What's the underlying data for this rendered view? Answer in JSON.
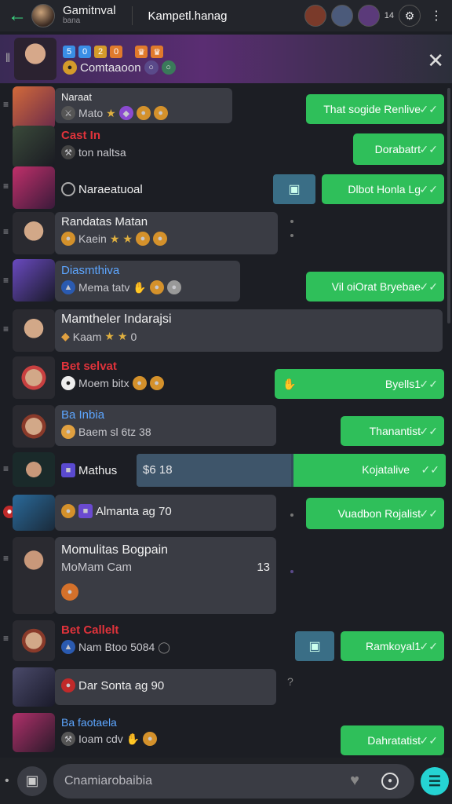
{
  "topbar": {
    "title": "Gamitnval",
    "subtitle": "bana",
    "center": "Kampetl.hanag",
    "counter": "14"
  },
  "banner": {
    "name": "Comtaaoon",
    "badges": [
      "5",
      "0",
      "2",
      "0"
    ]
  },
  "rows": [
    {
      "name": "Naraat",
      "sub": "Mato",
      "name_style": "normal"
    },
    {
      "name": "Cast In",
      "sub": "ton naltsa",
      "name_style": "red"
    },
    {
      "name": "Naraeatuoal",
      "sub": "",
      "name_style": "normal"
    },
    {
      "name": "Randatas Matan",
      "sub": "Kaein",
      "name_style": "normal"
    },
    {
      "name": "Diasmthiva",
      "sub": "Mema tatv",
      "name_style": "blue"
    },
    {
      "name": "Mamtheler Indarajsi",
      "sub": "Kaam",
      "count": "0",
      "name_style": "normal"
    },
    {
      "name": "Bet selvat",
      "sub": "Moem bitx",
      "name_style": "red"
    },
    {
      "name": "Ba Inbia",
      "sub": "Baem sl 6tz 38",
      "name_style": "blue"
    },
    {
      "name": "Mathus",
      "sub": "",
      "name_style": "normal"
    },
    {
      "name": "Almanta ag 70",
      "sub": "",
      "name_style": "normal"
    },
    {
      "name": "Momulitas Bogpain",
      "sub": "MoMam Cam",
      "count": "13",
      "name_style": "normal"
    },
    {
      "name": "Bet Callelt",
      "sub": "Nam Btoo 5084",
      "name_style": "red"
    },
    {
      "name": "Dar Sonta ag 90",
      "sub": "",
      "name_style": "normal"
    },
    {
      "name": "Ba faotaela",
      "sub": "Ioam cdv",
      "name_style": "blue"
    }
  ],
  "right_msgs": [
    "That sogide Renlive",
    "Dorabatrt",
    "Dlbot Honla Lg",
    "Vil oiOrat Bryebae",
    "Byells1",
    "Thanantist",
    "Kojatalive",
    "Vuadbon Rojalist",
    "Ramkoyal1",
    "Dahratatist"
  ],
  "progress": {
    "value_text": "$6 18",
    "level": 0.5
  },
  "composer": {
    "placeholder": "Cnamiarobaibia"
  },
  "colors": {
    "accent": "#2fbf5a",
    "send": "#25d3d3",
    "back": "#3ddc84"
  }
}
